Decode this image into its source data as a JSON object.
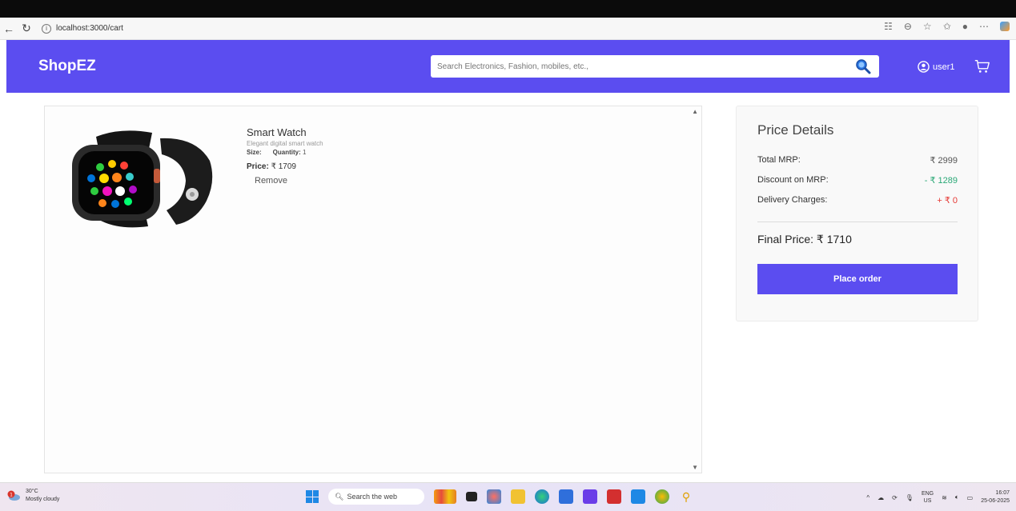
{
  "browser": {
    "url": "localhost:3000/cart"
  },
  "header": {
    "logo": "ShopEZ",
    "search_placeholder": "Search Electronics, Fashion, mobiles, etc.,",
    "username": "user1"
  },
  "cart": {
    "item": {
      "title": "Smart Watch",
      "description": "Elegant digital smart watch",
      "size_label": "Size:",
      "size_value": "",
      "quantity_label": "Quantity:",
      "quantity_value": "1",
      "price_label": "Price:",
      "price_value": "₹ 1709",
      "remove_label": "Remove"
    }
  },
  "price_details": {
    "title": "Price Details",
    "rows": [
      {
        "label": "Total MRP:",
        "value": "₹ 2999",
        "color": "#555555"
      },
      {
        "label": "Discount on MRP:",
        "value": "- ₹ 1289",
        "color": "#2aa876"
      },
      {
        "label": "Delivery Charges:",
        "value": "+ ₹ 0",
        "color": "#e53935"
      }
    ],
    "final_label": "Final Price:",
    "final_value": "₹ 1710",
    "place_order": "Place order"
  },
  "taskbar": {
    "weather_temp": "30°C",
    "weather_desc": "Mostly cloudy",
    "search_label": "Search the web",
    "lang_top": "ENG",
    "lang_bottom": "US",
    "time": "16:07",
    "date": "25-06-2025"
  },
  "colors": {
    "brand": "#5b4df0"
  }
}
